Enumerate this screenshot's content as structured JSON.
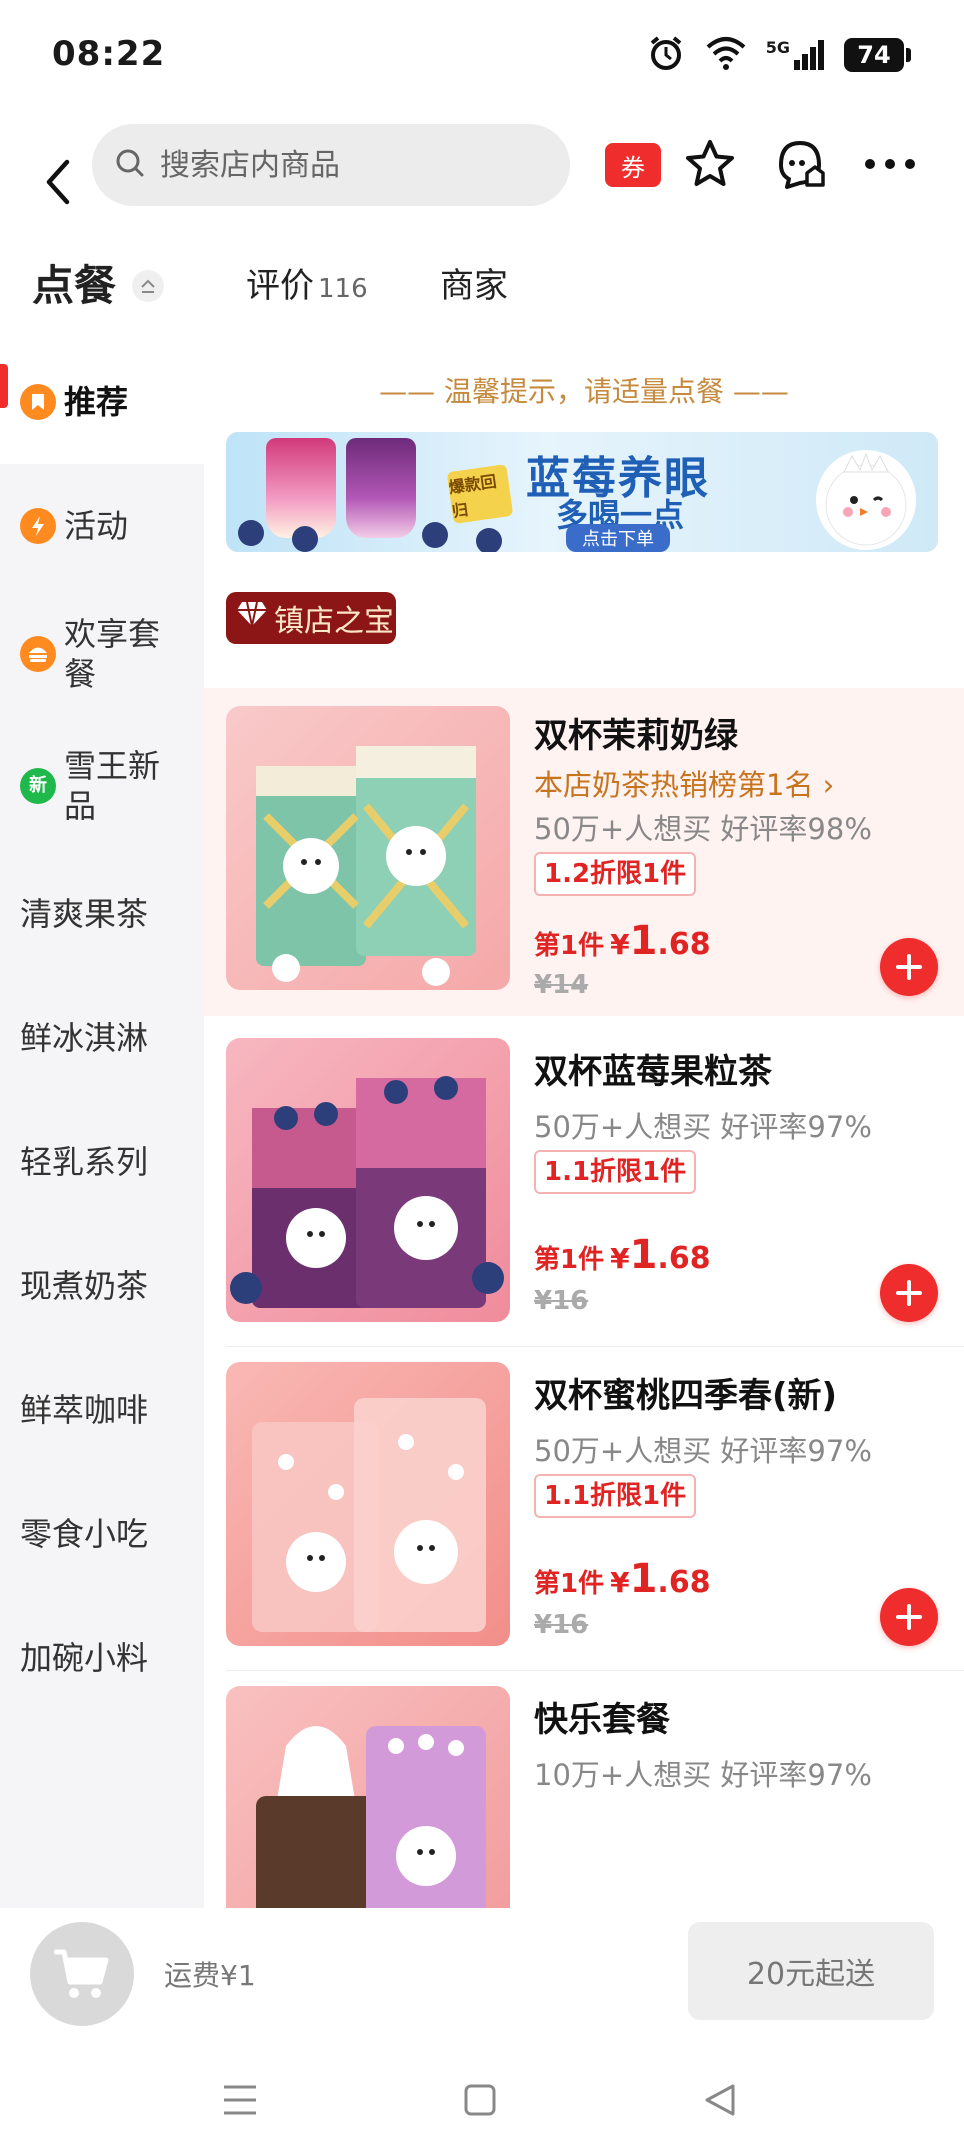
{
  "status": {
    "time": "08:22",
    "battery": "74",
    "network": "5G"
  },
  "nav": {
    "search_placeholder": "搜索店内商品",
    "coupon_label": "券"
  },
  "tabs": [
    {
      "label": "点餐"
    },
    {
      "label": "评价",
      "count": "116"
    },
    {
      "label": "商家"
    }
  ],
  "sidebar": {
    "items": [
      {
        "label": "推荐",
        "icon": "bookmark-icon",
        "color": "#ff8a1f"
      },
      {
        "label": "活动",
        "icon": "lightning-icon",
        "color": "#ff8a1f"
      },
      {
        "label": "欢享套餐",
        "icon": "burger-icon",
        "color": "#ff8a1f"
      },
      {
        "label": "雪王新品",
        "icon": "new-badge-icon",
        "color": "#1fb84a",
        "badge_text": "新"
      },
      {
        "label": "清爽果茶"
      },
      {
        "label": "鲜冰淇淋"
      },
      {
        "label": "轻乳系列"
      },
      {
        "label": "现煮奶茶"
      },
      {
        "label": "鲜萃咖啡"
      },
      {
        "label": "零食小吃"
      },
      {
        "label": "加碗小料"
      }
    ]
  },
  "main": {
    "tip": "—— 温馨提示，请适量点餐 ——",
    "banner": {
      "title": "蓝莓养眼",
      "subtitle": "多喝一点",
      "cta": "点击下单",
      "tag": "爆款回归"
    },
    "section_tag": "镇店之宝",
    "products": [
      {
        "name": "双杯茉莉奶绿",
        "rank": "本店奶茶热销榜第1名 ›",
        "stats": "50万+人想买  好评率98%",
        "discount": "1.2折限1件",
        "price_prefix": "第1件",
        "currency": "¥",
        "price_int": "1",
        "price_dec": ".68",
        "original_price": "¥14"
      },
      {
        "name": "双杯蓝莓果粒茶",
        "stats": "50万+人想买  好评率97%",
        "discount": "1.1折限1件",
        "price_prefix": "第1件",
        "currency": "¥",
        "price_int": "1",
        "price_dec": ".68",
        "original_price": "¥16"
      },
      {
        "name": "双杯蜜桃四季春(新)",
        "stats": "50万+人想买  好评率97%",
        "discount": "1.1折限1件",
        "price_prefix": "第1件",
        "currency": "¥",
        "price_int": "1",
        "price_dec": ".68",
        "original_price": "¥16"
      },
      {
        "name": "快乐套餐",
        "stats": "10万+人想买  好评率97%"
      }
    ]
  },
  "cart": {
    "delivery_fee": "运费¥1",
    "min_order": "20元起送"
  },
  "colors": {
    "accent": "#ef2d2d",
    "highlight_bg": "#fff3f2",
    "tip": "#c58a3e",
    "section_tag_bg": "#8c1515"
  }
}
